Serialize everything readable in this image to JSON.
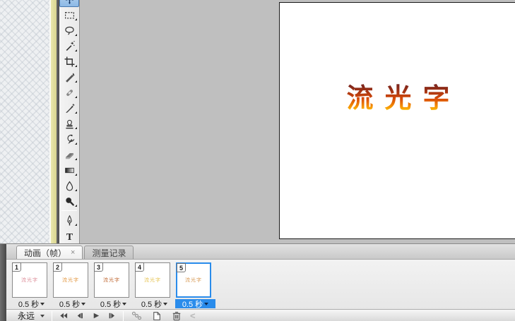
{
  "toolbar": {
    "tools": [
      {
        "name": "move",
        "selected": true
      },
      {
        "name": "marquee",
        "selected": false
      },
      {
        "name": "lasso",
        "selected": false
      },
      {
        "name": "magic-wand",
        "selected": false
      },
      {
        "name": "crop",
        "selected": false
      },
      {
        "name": "slice",
        "selected": false
      },
      {
        "name": "healing-brush",
        "selected": false
      },
      {
        "name": "brush",
        "selected": false
      },
      {
        "name": "clone-stamp",
        "selected": false
      },
      {
        "name": "history-brush",
        "selected": false
      },
      {
        "name": "eraser",
        "selected": false
      },
      {
        "name": "gradient",
        "selected": false
      },
      {
        "name": "blur",
        "selected": false
      },
      {
        "name": "dodge",
        "selected": false
      },
      {
        "name": "pen",
        "selected": false
      },
      {
        "name": "type",
        "selected": false
      }
    ]
  },
  "canvas": {
    "text": "流光字",
    "text_gradient": [
      "#5a2430",
      "#8c2a18",
      "#d84a08",
      "#f59000",
      "#ffe000"
    ]
  },
  "panel": {
    "tabs": [
      {
        "label": "动画（帧）",
        "close_label": "×",
        "active": true
      },
      {
        "label": "测量记录",
        "close_label": "",
        "active": false
      }
    ],
    "frames": [
      {
        "number": "1",
        "delay": "0.5 秒",
        "selected": false,
        "thumb_text": "流光字",
        "thumb_color": "#dd8f9a"
      },
      {
        "number": "2",
        "delay": "0.5 秒",
        "selected": false,
        "thumb_text": "流光字",
        "thumb_color": "#e39a45"
      },
      {
        "number": "3",
        "delay": "0.5 秒",
        "selected": false,
        "thumb_text": "流光字",
        "thumb_color": "#c06a35"
      },
      {
        "number": "4",
        "delay": "0.5 秒",
        "selected": false,
        "thumb_text": "流光字",
        "thumb_color": "#e6c455"
      },
      {
        "number": "5",
        "delay": "0.5 秒",
        "selected": true,
        "thumb_text": "流光字",
        "thumb_color": "#d79a55"
      }
    ],
    "loop": {
      "label": "永远"
    },
    "transport": [
      {
        "name": "first-frame"
      },
      {
        "name": "previous-frame"
      },
      {
        "name": "play"
      },
      {
        "name": "next-frame"
      }
    ],
    "actions": [
      {
        "name": "tween"
      },
      {
        "name": "duplicate-frame"
      },
      {
        "name": "delete-frame"
      }
    ],
    "scroll_left_label": "<"
  },
  "colors": {
    "selection_blue": "#2a8ceb",
    "workspace_gray": "#bfbfbf"
  }
}
